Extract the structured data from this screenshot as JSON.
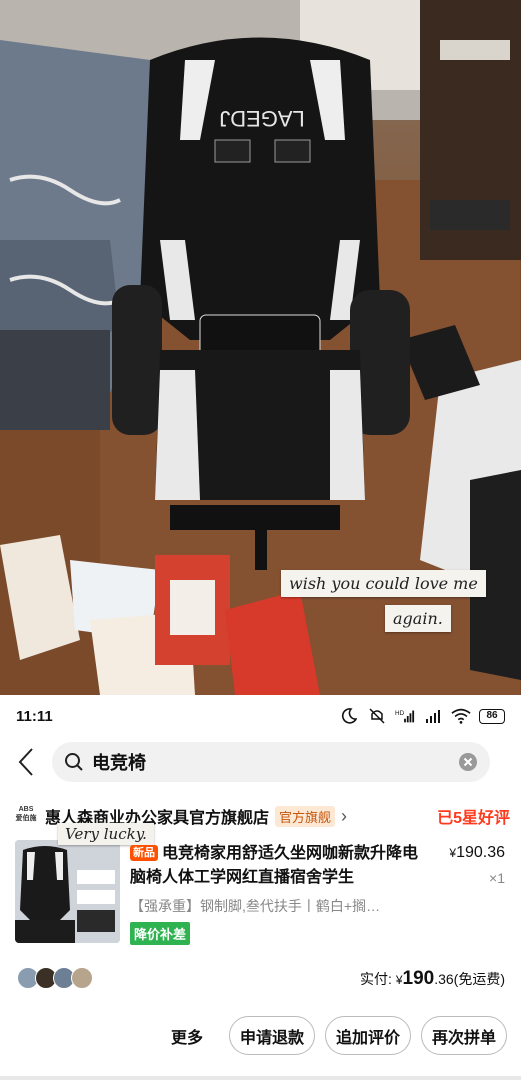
{
  "photo": {
    "chair_brand": "LAGEDJ",
    "captions": [
      "wish you could love me",
      "again."
    ]
  },
  "status_bar": {
    "time": "11:11",
    "battery": "86",
    "icons": [
      "moon-icon",
      "mute-icon",
      "signal-hd-icon",
      "signal-icon",
      "wifi-icon",
      "battery-icon"
    ]
  },
  "search": {
    "query": "电竞椅",
    "icons": [
      "back-icon",
      "search-icon",
      "clear-icon"
    ]
  },
  "order": {
    "store_logo": "ABS 爱伯施",
    "store_name": "惠人森商业办公家具官方旗舰店",
    "store_tag": "官方旗舰",
    "rating": "已5星好评",
    "sticker": "Very lucky.",
    "product_badge": "新品",
    "product_title": "电竞椅家用舒适久坐网咖新款升降电脑椅人体工学网红直播宿舍学生",
    "price_symbol": "¥",
    "price": "190.36",
    "quantity": "×1",
    "spec": "【强承重】钢制脚,叁代扶手丨鹤白+搁…",
    "promo": "降价补差",
    "paid_label": "实付:",
    "paid_symbol": "¥",
    "paid_int": "190",
    "paid_dec": ".36",
    "shipping": "(免运费)"
  },
  "actions": {
    "more": "更多",
    "refund": "申请退款",
    "review": "追加评价",
    "reorder": "再次拼单"
  },
  "colors": {
    "accent": "#ff3b1f",
    "promo_green": "#2fb350",
    "tag_bg": "#fde8d4"
  }
}
